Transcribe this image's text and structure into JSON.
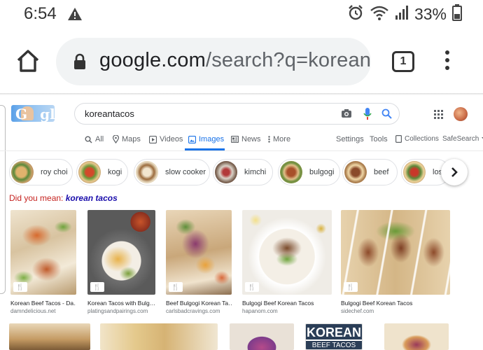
{
  "status_bar": {
    "time": "6:54",
    "battery": "33%"
  },
  "browser": {
    "url_host": "google.com",
    "url_rest": "/search?q=koreanta",
    "tab_count": "1"
  },
  "search": {
    "query": "koreantacos"
  },
  "nav_tabs": [
    "All",
    "Maps",
    "Videos",
    "Images",
    "News",
    "More"
  ],
  "nav_right": {
    "settings": "Settings",
    "tools": "Tools",
    "collections": "Collections",
    "safesearch": "SafeSearch"
  },
  "chips": [
    "roy choi",
    "kogi",
    "slow cooker",
    "kimchi",
    "bulgogi",
    "beef",
    "los"
  ],
  "did_you_mean": {
    "prefix": "Did you mean:",
    "suggestion": "korean tacos"
  },
  "results": [
    {
      "title": "Korean Beef Tacos - Da…",
      "site": "damndelicious.net"
    },
    {
      "title": "Korean Tacos with Bulg…",
      "site": "platingsandpairings.com"
    },
    {
      "title": "Beef Bulgogi Korean Ta…",
      "site": "carlsbadcravings.com"
    },
    {
      "title": "Bulgogi Beef Korean Tacos",
      "site": "hapanom.com"
    },
    {
      "title": "Bulgogi Beef Korean Tacos",
      "site": "sidechef.com"
    }
  ],
  "row2_text": {
    "line1": "KOREAN",
    "line2": "BEEF TACOS"
  },
  "colors": {
    "accent": "#1a73e8",
    "did_you_mean": "#c5221f",
    "suggestion": "#1a0dab"
  }
}
